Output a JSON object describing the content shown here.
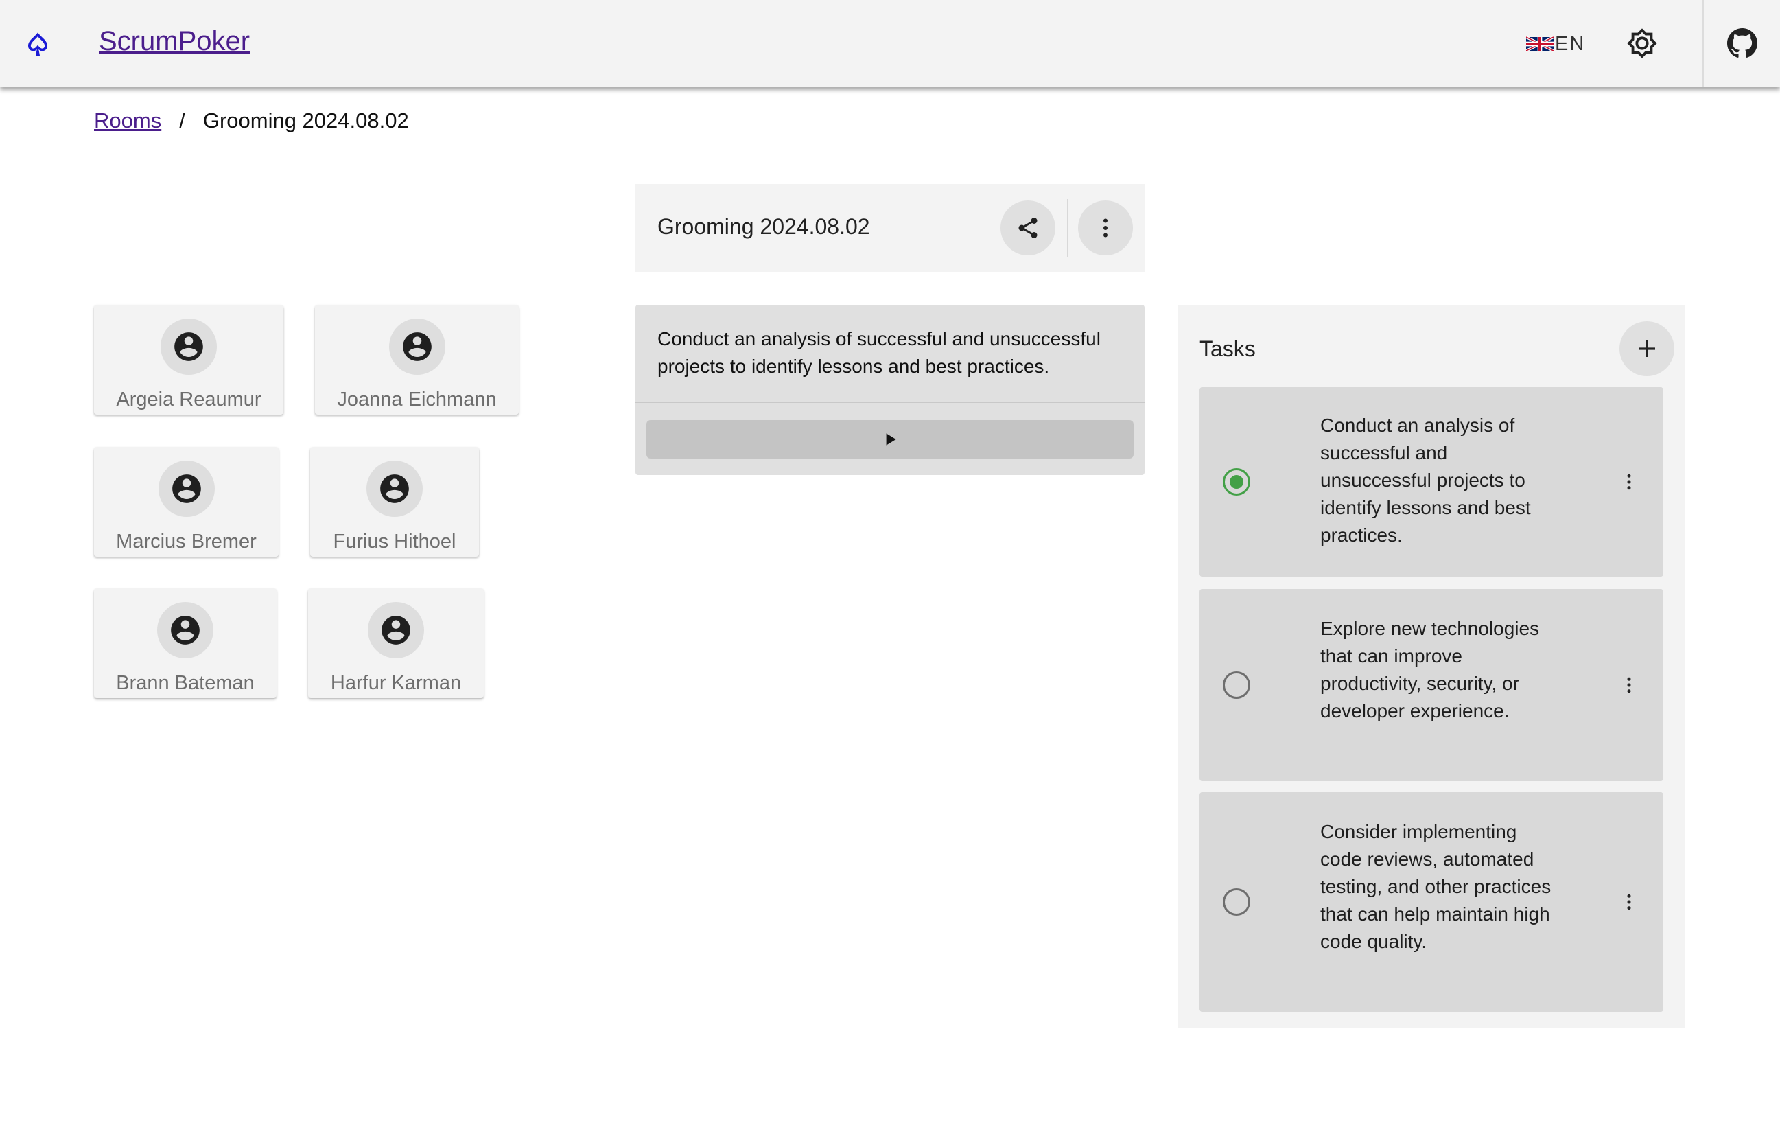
{
  "header": {
    "brand": "ScrumPoker",
    "language": "EN",
    "icons": [
      "spade-logo-icon",
      "uk-flag-icon",
      "brightness-icon",
      "github-icon"
    ]
  },
  "breadcrumb": {
    "rooms_link": "Rooms",
    "separator": "/",
    "current": "Grooming 2024.08.02"
  },
  "room": {
    "title": "Grooming 2024.08.02",
    "icons": [
      "share-icon",
      "more-vert-icon"
    ]
  },
  "participants": [
    {
      "name": "Argeia Reaumur"
    },
    {
      "name": "Joanna Eichmann"
    },
    {
      "name": "Marcius Bremer"
    },
    {
      "name": "Furius Hithoel"
    },
    {
      "name": "Brann Bateman"
    },
    {
      "name": "Harfur Karman"
    }
  ],
  "current_task": {
    "text": "Conduct an analysis of successful and unsuccessful projects to identify lessons and best practices.",
    "icon": "play-icon"
  },
  "tasks": {
    "title": "Tasks",
    "add_icon": "plus-icon",
    "items": [
      {
        "text": "Conduct an analysis of successful and unsuccessful projects to identify lessons and best practices.",
        "selected": true
      },
      {
        "text": "Explore new technologies that can improve productivity, security, or developer experience.",
        "selected": false
      },
      {
        "text": "Consider implementing code reviews, automated testing, and other practices that can help maintain high code quality.",
        "selected": false
      }
    ]
  },
  "colors": {
    "brand_link": "#4b1e8c",
    "logo": "#1a1ad6",
    "selected_radio": "#43a047",
    "surface": "#f3f3f3",
    "card": "#d9d9d9"
  }
}
